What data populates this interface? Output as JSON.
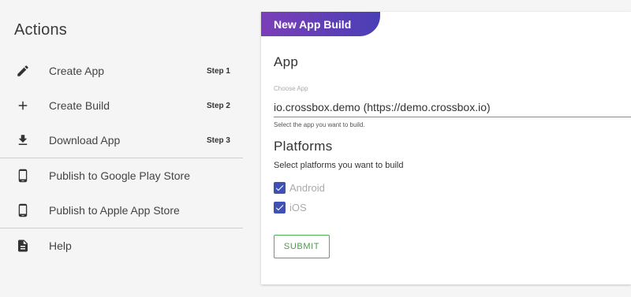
{
  "sidebar": {
    "title": "Actions",
    "items": [
      {
        "label": "Create App",
        "step": "Step 1",
        "icon": "pencil-icon"
      },
      {
        "label": "Create Build",
        "step": "Step 2",
        "icon": "plus-icon"
      },
      {
        "label": "Download App",
        "step": "Step 3",
        "icon": "download-icon"
      },
      {
        "label": "Publish to Google Play Store",
        "icon": "phone-icon"
      },
      {
        "label": "Publish to Apple App Store",
        "icon": "phone-icon"
      },
      {
        "label": "Help",
        "icon": "document-icon"
      }
    ]
  },
  "card": {
    "tab_title": "New App Build",
    "app_section": {
      "heading": "App",
      "caption": "Choose App",
      "value": "io.crossbox.demo (https://demo.crossbox.io)",
      "helper": "Select the app you want to build."
    },
    "platforms_section": {
      "heading": "Platforms",
      "description": "Select platforms you want to build",
      "options": [
        {
          "label": "Android",
          "checked": true
        },
        {
          "label": "iOS",
          "checked": true
        }
      ]
    },
    "submit_label": "SUBMIT"
  },
  "colors": {
    "accent_gradient_start": "#7b3fb8",
    "accent_gradient_end": "#4a3fb5",
    "checkbox": "#3f51b5",
    "submit": "#4caf50"
  }
}
